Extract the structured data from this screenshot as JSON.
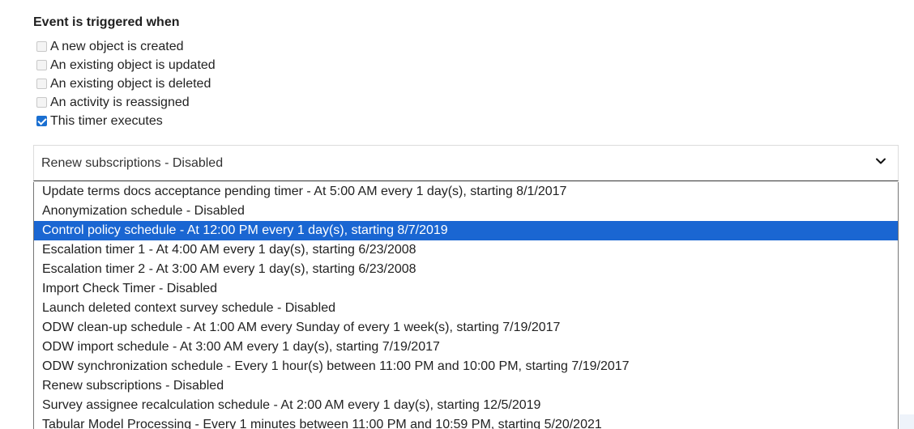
{
  "section": {
    "title": "Event is triggered when"
  },
  "checkboxes": [
    {
      "label": "A new object is created",
      "checked": false,
      "disabled": true
    },
    {
      "label": "An existing object is updated",
      "checked": false,
      "disabled": true
    },
    {
      "label": "An existing object is deleted",
      "checked": false,
      "disabled": true
    },
    {
      "label": "An activity is reassigned",
      "checked": false,
      "disabled": true
    },
    {
      "label": "This timer executes",
      "checked": true,
      "disabled": false
    }
  ],
  "select": {
    "value": "Renew subscriptions - Disabled",
    "icon": "chevron-down-icon"
  },
  "dropdown": {
    "highlighted_index": 2,
    "options": [
      "Update terms docs acceptance pending timer - At 5:00 AM every 1 day(s), starting 8/1/2017",
      "Anonymization schedule - Disabled",
      "Control policy schedule - At 12:00 PM every 1 day(s), starting 8/7/2019",
      "Escalation timer 1 - At 4:00 AM every 1 day(s), starting 6/23/2008",
      "Escalation timer 2 - At 3:00 AM every 1 day(s), starting 6/23/2008",
      "Import Check Timer - Disabled",
      "Launch deleted context survey schedule - Disabled",
      "ODW clean-up schedule - At 1:00 AM every Sunday of every 1 week(s), starting 7/19/2017",
      "ODW import schedule - At 3:00 AM every 1 day(s), starting 7/19/2017",
      "ODW synchronization schedule - Every 1 hour(s) between 11:00 PM and 10:00 PM, starting 7/19/2017",
      "Renew subscriptions - Disabled",
      "Survey assignee recalculation schedule - At 2:00 AM every 1 day(s), starting 12/5/2019",
      "Tabular Model Processing - Every 1 minutes between 11:00 PM and 10:59 PM, starting 5/20/2021"
    ]
  },
  "colors": {
    "highlight": "#1a66d2",
    "checkbox_checked": "#1a6fd1"
  }
}
